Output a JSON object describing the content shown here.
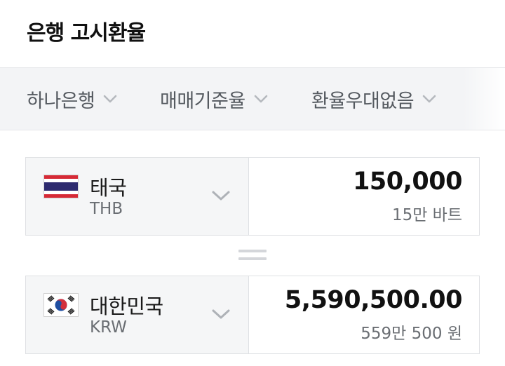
{
  "header": {
    "title": "은행 고시환율"
  },
  "filters": {
    "bank": "하나은행",
    "rate_type": "매매기준율",
    "preference": "환율우대없음"
  },
  "from": {
    "country": "태국",
    "code": "THB",
    "amount": "150,000",
    "amount_words": "15만 바트",
    "flag_icon": "thailand-flag-icon"
  },
  "equals_icon": "equals-icon",
  "to": {
    "country": "대한민국",
    "code": "KRW",
    "amount": "5,590,500.00",
    "amount_words": "559만 500 원",
    "flag_icon": "south-korea-flag-icon"
  },
  "colors": {
    "filter_bar_bg": "#f3f4f6",
    "selector_bg": "#f5f6f7",
    "border": "#dfe1e4",
    "muted_text": "#6a6e73"
  }
}
